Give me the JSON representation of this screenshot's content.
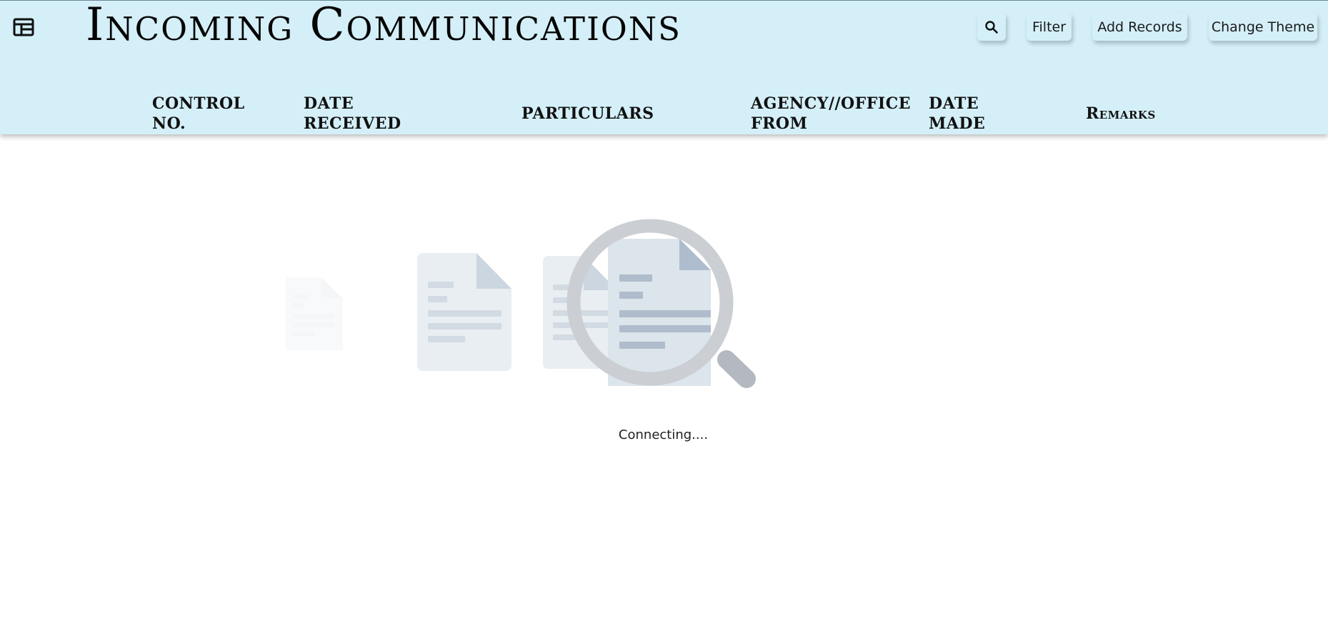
{
  "header": {
    "title": "Incoming Communications",
    "app_icon": "table-layout-icon",
    "buttons": {
      "search_icon": "search-icon",
      "filter_label": "Filter",
      "add_label": "Add Records",
      "theme_label": "Change Theme"
    },
    "background_color": "#d4eff8"
  },
  "table": {
    "columns": [
      "CONTROL NO.",
      "DATE RECEIVED",
      "PARTICULARS",
      "AGENCY//OFFICE FROM",
      "DATE MADE",
      "Remarks"
    ]
  },
  "loading": {
    "status_text": "Connecting....",
    "illustration": "document-search-illustration"
  }
}
